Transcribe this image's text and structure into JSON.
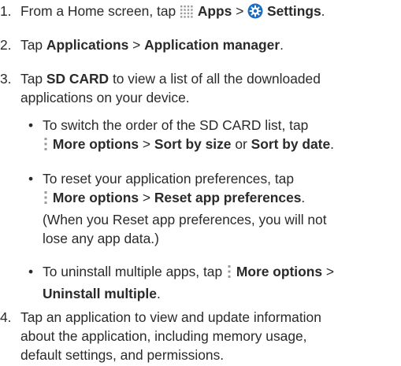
{
  "steps": [
    {
      "number": "1.",
      "parts": {
        "a": "From a Home screen, tap",
        "apps": "Apps",
        "sep": ">",
        "settings": "Settings",
        "end": "."
      },
      "icons": [
        "apps-grid-icon",
        "settings-gear-icon"
      ]
    },
    {
      "number": "2.",
      "parts": {
        "a": "Tap",
        "applications": "Applications",
        "sep": ">",
        "manager": "Application manager",
        "end": "."
      }
    },
    {
      "number": "3.",
      "parts": {
        "a": "Tap",
        "sdcard": "SD CARD",
        "b": "to view a list of all the downloaded",
        "c": "applications on your device."
      },
      "bullets": [
        {
          "line1": "To switch the order of the SD CARD list, tap",
          "more": "More options",
          "sep": ">",
          "opt1": "Sort by size",
          "or": "or",
          "opt2": "Sort by date",
          "end": "."
        },
        {
          "line1": "To reset your application preferences, tap",
          "more": "More options",
          "sep": ">",
          "opt": "Reset app preferences",
          "end": ".",
          "note1": "(When you Reset app preferences, you will not",
          "note2": "lose any app data.)"
        },
        {
          "a": "To uninstall multiple apps, tap",
          "more": "More options",
          "sep": ">",
          "opt": "Uninstall multiple",
          "end": "."
        }
      ]
    },
    {
      "number": "4.",
      "lines": [
        "Tap an application to view and update information",
        "about the application, including memory usage,",
        "default settings, and permissions."
      ]
    }
  ],
  "colors": {
    "text": "#2a2a2a",
    "gear_blue": "#1a6fc4",
    "icon_gray": "#9a9a9a"
  }
}
